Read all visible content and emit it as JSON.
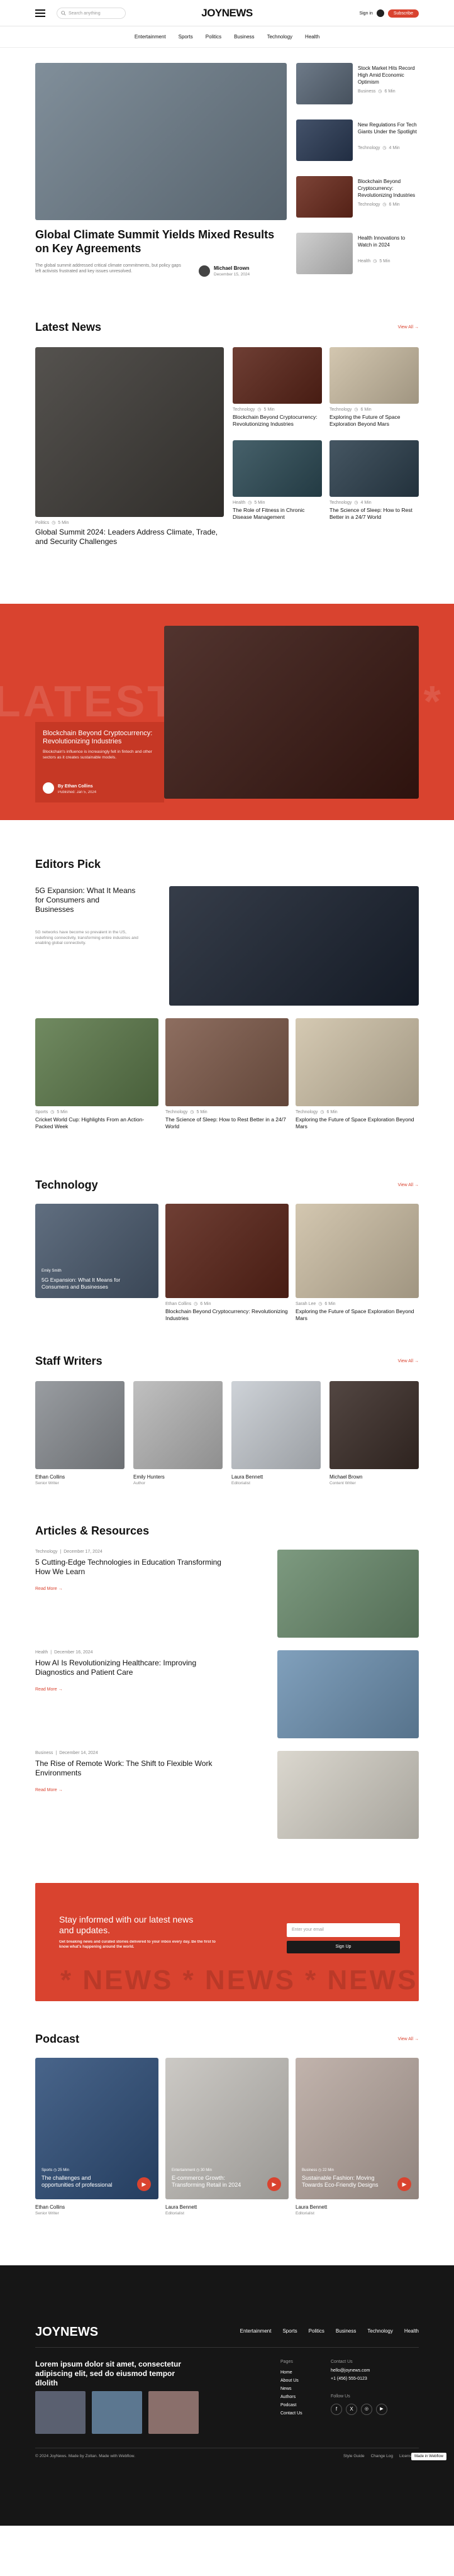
{
  "header": {
    "search_placeholder": "Search anything",
    "logo_a": "JOY",
    "logo_b": "NEWS",
    "signin": "Sign in",
    "subscribe": "Subscribe"
  },
  "nav": [
    "Entertainment",
    "Sports",
    "Politics",
    "Business",
    "Technology",
    "Health"
  ],
  "hero": {
    "title": "Global Climate Summit Yields Mixed Results on Key Agreements",
    "excerpt": "The global summit addressed critical climate commitments, but policy gaps left activists frustrated and key issues unresolved.",
    "author": "Michael Brown",
    "date": "December 15, 2024"
  },
  "side": [
    {
      "title": "Stock Market Hits Record High Amid Economic Optimism",
      "cat": "Business",
      "time": "6 Min"
    },
    {
      "title": "New Regulations For Tech Giants Under the Spotlight",
      "cat": "Technology",
      "time": "4 Min"
    },
    {
      "title": "Blockchain Beyond Cryptocurrency: Revolutionizing Industries",
      "cat": "Technology",
      "time": "6 Min"
    },
    {
      "title": "Health Innovations to Watch in 2024",
      "cat": "Health",
      "time": "5 Min"
    }
  ],
  "latest": {
    "heading": "Latest News",
    "viewall": "View All  →",
    "main": {
      "cat": "Politics",
      "time": "5 Min",
      "title": "Global Summit 2024: Leaders Address Climate, Trade, and Security Challenges"
    },
    "items": [
      {
        "cat": "Technology",
        "time": "5 Min",
        "title": "Blockchain Beyond Cryptocurrency: Revolutionizing Industries"
      },
      {
        "cat": "Technology",
        "time": "6 Min",
        "title": "Exploring the Future of Space Exploration Beyond Mars"
      },
      {
        "cat": "Health",
        "time": "5 Min",
        "title": "The Role of Fitness in Chronic Disease Management"
      },
      {
        "cat": "Technology",
        "time": "4 Min",
        "title": "The Science of Sleep: How to Rest Better in a 24/7 World"
      }
    ]
  },
  "feature": {
    "bigtext": "LATEST * LATEST *",
    "title": "Blockchain Beyond Cryptocurrency: Revolutionizing Industries",
    "excerpt": "Blockchain's influence is increasingly felt in fintech and other sectors as it creates sustainable models.",
    "author": "By Ethan Collins",
    "date": "Published: Jan 5, 2024"
  },
  "editors": {
    "heading": "Editors Pick",
    "main_title": "5G Expansion: What It Means for Consumers and Businesses",
    "main_excerpt": "5G networks have become so prevalent in the US, redefining connectivity, transforming entire industries and enabling global connectivity.",
    "items": [
      {
        "cat": "Sports",
        "time": "5 Min",
        "title": "Cricket World Cup: Highlights From an Action-Packed Week"
      },
      {
        "cat": "Technology",
        "time": "5 Min",
        "title": "The Science of Sleep: How to Rest Better in a 24/7 World"
      },
      {
        "cat": "Technology",
        "time": "6 Min",
        "title": "Exploring the Future of Space Exploration Beyond Mars"
      }
    ]
  },
  "technology": {
    "heading": "Technology",
    "viewall": "View All  →",
    "items": [
      {
        "author": "Emily Smith",
        "time": "4 Min",
        "title": "5G Expansion: What It Means for Consumers and Businesses"
      },
      {
        "author": "Ethan Collins",
        "time": "6 Min",
        "title": "Blockchain Beyond Cryptocurrency: Revolutionizing Industries"
      },
      {
        "author": "Sarah Lee",
        "time": "6 Min",
        "title": "Exploring the Future of Space Exploration Beyond Mars"
      }
    ]
  },
  "staff": {
    "heading": "Staff Writers",
    "viewall": "View All  →",
    "people": [
      {
        "name": "Ethan Collins",
        "role": "Senior Writer"
      },
      {
        "name": "Emily Hunters",
        "role": "Author"
      },
      {
        "name": "Laura Bennett",
        "role": "Editorialist"
      },
      {
        "name": "Michael Brown",
        "role": "Content Writer"
      }
    ]
  },
  "articles": {
    "heading": "Articles & Resources",
    "readmore": "Read More  →",
    "items": [
      {
        "cat": "Technology",
        "date": "December 17, 2024",
        "title": "5 Cutting-Edge Technologies in Education Transforming How We Learn"
      },
      {
        "cat": "Health",
        "date": "December 16, 2024",
        "title": "How AI Is Revolutionizing Healthcare: Improving Diagnostics and Patient Care"
      },
      {
        "cat": "Business",
        "date": "December 14, 2024",
        "title": "The Rise of Remote Work: The Shift to Flexible Work Environments"
      }
    ]
  },
  "newsletter": {
    "title": "Stay informed with our latest news and updates.",
    "sub": "Get breaking news and curated stories delivered to your inbox every day. Be the first to know what's happening around the world.",
    "placeholder": "Enter your email",
    "button": "Sign Up",
    "bigtext": "* NEWS * NEWS * NEWS"
  },
  "podcast": {
    "heading": "Podcast",
    "viewall": "View All  →",
    "items": [
      {
        "cat": "Sports",
        "time": "25 Min",
        "title": "The challenges and opportunities of professional",
        "name": "Ethan Collins",
        "role": "Senior Writer"
      },
      {
        "cat": "Entertainment",
        "time": "30 Min",
        "title": "E-commerce Growth: Transforming Retail in 2024",
        "name": "Laura Bennett",
        "role": "Editorialist"
      },
      {
        "cat": "Business",
        "time": "22 Min",
        "title": "Sustainable Fashion: Moving Towards Eco-Friendly Designs",
        "name": "Laura Bennett",
        "role": "Editorialist"
      }
    ]
  },
  "footer": {
    "logo_a": "JOY",
    "logo_b": "NEWS",
    "nav": [
      "Entertainment",
      "Sports",
      "Politics",
      "Business",
      "Technology",
      "Health"
    ],
    "tagline": "Lorem ipsum dolor sit amet, consectetur adipiscing elit, sed do eiusmod tempor dlolith",
    "pages_label": "Pages",
    "pages": [
      "Home",
      "About Us",
      "News",
      "Authors",
      "Podcast",
      "Contact Us"
    ],
    "contact_label": "Contact Us",
    "email": "hello@joynews.com",
    "phone": "+1 (456) 555-0123",
    "follow_label": "Follow Us",
    "copyright": "© 2024 JoyNews. Made by Zoltan. Made with Webflow.",
    "links": [
      "Style Guide",
      "Change Log",
      "Licenses"
    ],
    "badge": "Made in Webflow"
  }
}
